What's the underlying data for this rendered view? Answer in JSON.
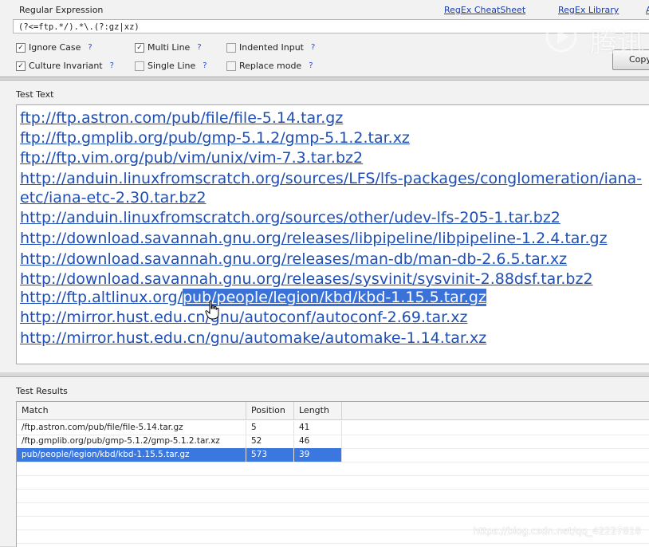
{
  "regex_panel": {
    "title": "Regular Expression",
    "links": [
      "RegEx CheatSheet",
      "RegEx Library",
      "A"
    ],
    "expression": "(?<=ftp.*/).*\\.(?:gz|xz)",
    "options": [
      {
        "label": "Ignore Case",
        "checked": true,
        "help": "?"
      },
      {
        "label": "Multi Line",
        "checked": true,
        "help": "?"
      },
      {
        "label": "Indented Input",
        "checked": false,
        "help": "?"
      },
      {
        "label": "Culture Invariant",
        "checked": true,
        "help": "?"
      },
      {
        "label": "Single Line",
        "checked": false,
        "help": "?"
      },
      {
        "label": "Replace mode",
        "checked": false,
        "help": "?"
      }
    ],
    "copy_label": "Copy",
    "watermark_text": "腾讯"
  },
  "test_panel": {
    "title": "Test Text",
    "lines": [
      "ftp://ftp.astron.com/pub/file/file-5.14.tar.gz",
      "ftp://ftp.gmplib.org/pub/gmp-5.1.2/gmp-5.1.2.tar.xz",
      "ftp://ftp.vim.org/pub/vim/unix/vim-7.3.tar.bz2",
      "http://anduin.linuxfromscratch.org/sources/LFS/lfs-packages/conglomeration/iana-",
      "etc/iana-etc-2.30.tar.bz2",
      "http://anduin.linuxfromscratch.org/sources/other/udev-lfs-205-1.tar.bz2",
      "http://download.savannah.gnu.org/releases/libpipeline/libpipeline-1.2.4.tar.gz",
      "http://download.savannah.gnu.org/releases/man-db/man-db-2.6.5.tar.xz",
      "http://download.savannah.gnu.org/releases/sysvinit/sysvinit-2.88dsf.tar.bz2",
      "",
      "http://mirror.hust.edu.cn/gnu/autoconf/autoconf-2.69.tar.xz",
      "http://mirror.hust.edu.cn/gnu/automake/automake-1.14.tar.xz"
    ],
    "selected_line_prefix": "http://ftp.altlinux.org/",
    "selected_line_highlight": "pub/people/legion/kbd/kbd-1.15.5.tar.gz"
  },
  "results_panel": {
    "title": "Test Results",
    "columns": [
      "Match",
      "Position",
      "Length"
    ],
    "rows": [
      {
        "match": "/ftp.astron.com/pub/file/file-5.14.tar.gz",
        "position": "5",
        "length": "41"
      },
      {
        "match": "/ftp.gmplib.org/pub/gmp-5.1.2/gmp-5.1.2.tar.xz",
        "position": "52",
        "length": "46"
      },
      {
        "match": "pub/people/legion/kbd/kbd-1.15.5.tar.gz",
        "position": "573",
        "length": "39"
      }
    ],
    "watermark": "https://blog.csdn.net/qq_42227818"
  }
}
